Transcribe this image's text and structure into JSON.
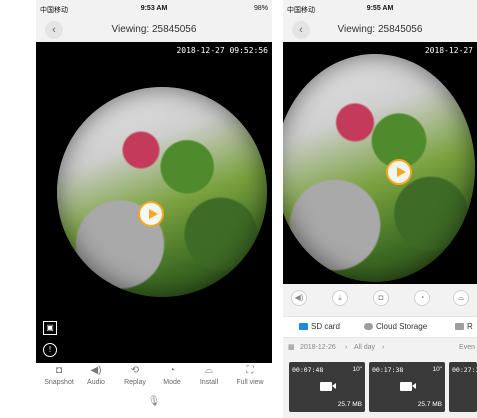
{
  "left_screen": {
    "status": {
      "carrier": "中国移动",
      "time": "9:53 AM",
      "battery": "98%"
    },
    "nav": {
      "title": "Viewing: 25845056"
    },
    "video": {
      "timestamp": "2018-12-27 09:52:56"
    },
    "toolbar": [
      {
        "icon": "camera-icon",
        "glyph": "◘",
        "label": "Snapshot"
      },
      {
        "icon": "speaker-icon",
        "glyph": "◀)",
        "label": "Audio"
      },
      {
        "icon": "replay-icon",
        "glyph": "⟲",
        "label": "Replay"
      },
      {
        "icon": "mode-icon",
        "glyph": "◔",
        "label": "Mode"
      },
      {
        "icon": "install-icon",
        "glyph": "⌓",
        "label": "Install"
      },
      {
        "icon": "fullscreen-icon",
        "glyph": "⛶",
        "label": "Full view"
      }
    ],
    "mic_glyph": "🎙",
    "gallery_glyph": "▣",
    "alert_glyph": "!"
  },
  "right_screen": {
    "status": {
      "carrier": "中国移动",
      "time": "9:55 AM"
    },
    "nav": {
      "title": "Viewing: 25845056"
    },
    "video": {
      "timestamp": "2018-12-27"
    },
    "toolbar_glyphs": [
      "◀)",
      "⤓",
      "◘",
      "◔",
      "⌓"
    ],
    "tabs": [
      {
        "label": "SD card",
        "color": "#1e88e5"
      },
      {
        "label": "Cloud Storage",
        "color": "#9e9e9e"
      },
      {
        "label": "R",
        "color": "#9e9e9e"
      }
    ],
    "filter": {
      "date": "2018-12-26",
      "range": "All day",
      "right": "Even"
    },
    "clips": [
      {
        "time": "00:07:48",
        "duration": "10\"",
        "size": "25.7 MB"
      },
      {
        "time": "00:17:38",
        "duration": "10\"",
        "size": "25.7 MB"
      },
      {
        "time": "00:27:3",
        "duration": "",
        "size": ""
      }
    ]
  }
}
